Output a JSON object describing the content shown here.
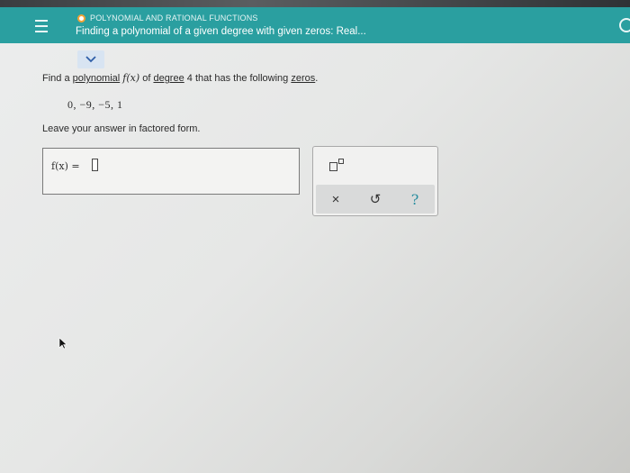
{
  "header": {
    "category": "POLYNOMIAL AND RATIONAL FUNCTIONS",
    "title": "Finding a polynomial of a given degree with given zeros: Real..."
  },
  "question": {
    "prefix": "Find a ",
    "polynomial_link": "polynomial",
    "fx": "f(x)",
    "of_text": " of ",
    "degree_link": "degree",
    "middle": " 4 that has the following ",
    "zeros_link": "zeros",
    "suffix": ".",
    "zeros": "0,  −9,  −5,  1",
    "instruction": "Leave your answer in factored form."
  },
  "answer": {
    "label": "f(x) ="
  },
  "toolbar": {
    "clear_label": "×",
    "undo_label": "↺",
    "help_label": "?"
  },
  "icons": {
    "menu": "hamburger-menu-icon",
    "category": "circle-icon",
    "chevron": "chevron-down-icon",
    "exponent": "exponent-icon",
    "pointer": "mouse-pointer-icon"
  },
  "colors": {
    "header": "#2a9fa0",
    "accent_orange": "#f2a336",
    "help_blue": "#2a8ea0"
  }
}
